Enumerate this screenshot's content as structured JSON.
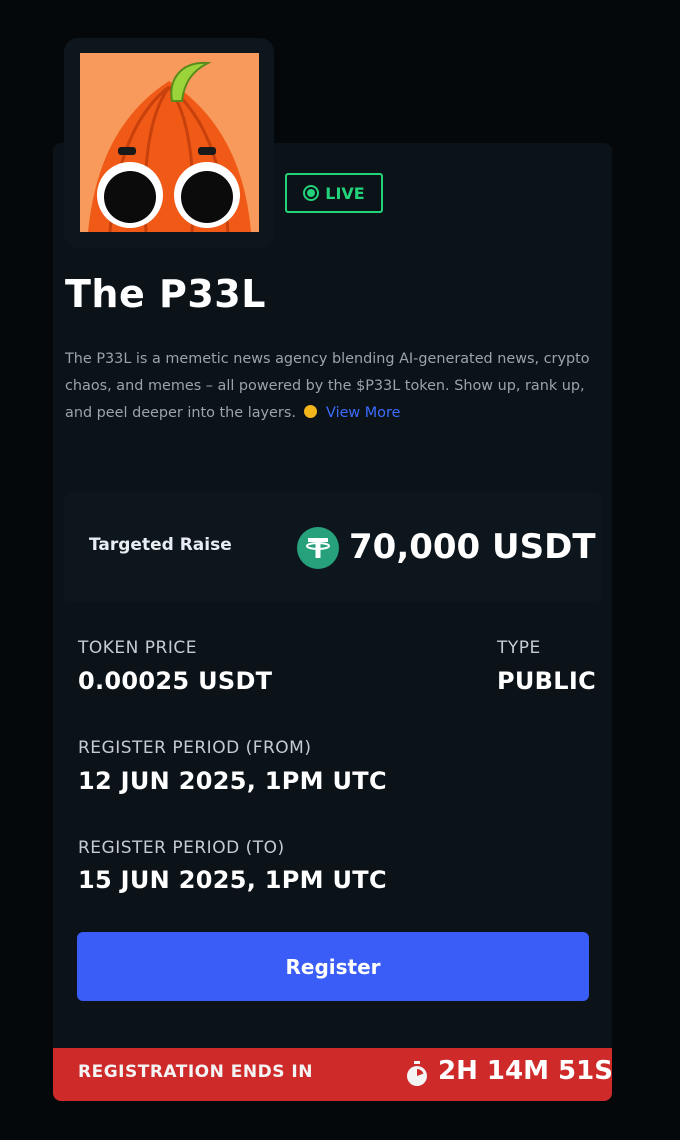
{
  "project": {
    "name": "The P33L",
    "status": "LIVE",
    "description": "The P33L is a memetic news agency blending AI-generated news, crypto chaos, and memes – all powered by the $P33L token. Show up, rank up, and peel deeper into the layers.",
    "view_more": "View More"
  },
  "raise": {
    "label": "Targeted Raise",
    "value": "70,000 USDT",
    "icon": "tether-icon"
  },
  "details": {
    "token_price_label": "TOKEN PRICE",
    "token_price_value": "0.00025 USDT",
    "type_label": "TYPE",
    "type_value": "PUBLIC",
    "from_label": "REGISTER PERIOD (FROM)",
    "from_value": "12 JUN 2025, 1PM UTC",
    "to_label": "REGISTER PERIOD (TO)",
    "to_value": "15 JUN 2025, 1PM UTC"
  },
  "actions": {
    "register_label": "Register"
  },
  "countdown": {
    "label": "REGISTRATION ENDS IN",
    "value": "2H 14M 51S",
    "icon": "stopwatch-icon"
  },
  "colors": {
    "background": "#05080b",
    "card": "#0b1218",
    "live": "#22d37a",
    "button": "#3a5cf7",
    "alert": "#cf2a2a",
    "link": "#3b6cff",
    "tether": "#26a17b"
  }
}
